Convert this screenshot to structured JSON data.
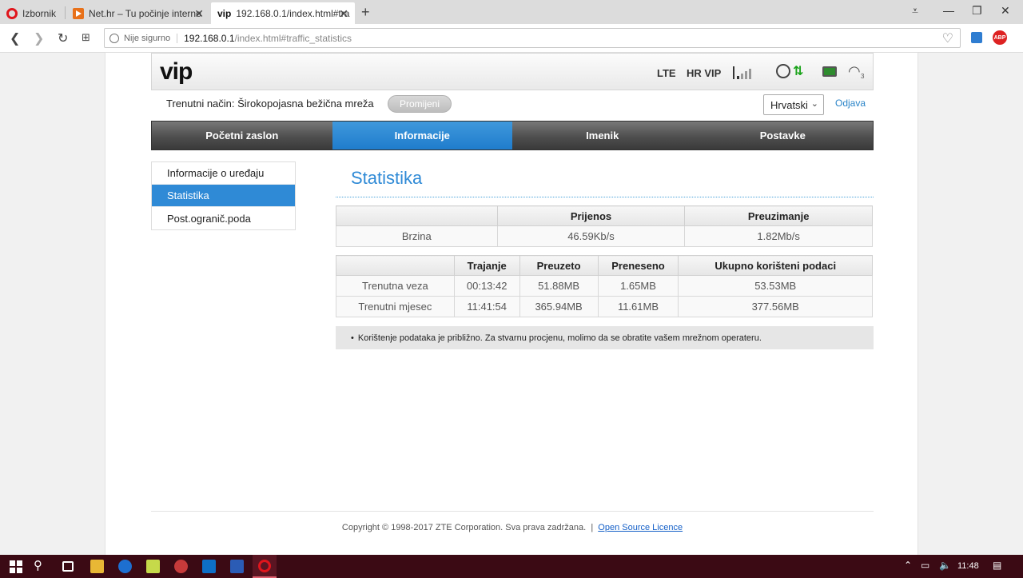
{
  "browser": {
    "tabs": [
      {
        "label": "Izbornik",
        "icon": "opera-icon"
      },
      {
        "label": "Net.hr – Tu počinje interne",
        "icon": "nethr-icon"
      },
      {
        "label": "192.168.0.1/index.html#tra",
        "prefix": "vip",
        "icon": "vip-icon"
      }
    ],
    "security_label": "Nije sigurno",
    "url_host": "192.168.0.1",
    "url_path": "/index.html#traffic_statistics",
    "adblock_label": "ABP"
  },
  "header": {
    "logo": "vip",
    "network_type": "LTE",
    "operator": "HR VIP",
    "wifi_clients": "3"
  },
  "modebar": {
    "mode_text": "Trenutni način: Širokopojasna bežična mreža",
    "change_button": "Promijeni",
    "language": "Hrvatski",
    "logout": "Odjava"
  },
  "nav": {
    "tabs": [
      "Početni zaslon",
      "Informacije",
      "Imenik",
      "Postavke"
    ],
    "active": 1
  },
  "sidemenu": {
    "items": [
      "Informacije o uređaju",
      "Statistika",
      "Post.ogranič.poda"
    ],
    "active": 1
  },
  "content": {
    "title": "Statistika",
    "speed_table": {
      "headers": [
        "",
        "Prijenos",
        "Preuzimanje"
      ],
      "rows": [
        [
          "Brzina",
          "46.59Kb/s",
          "1.82Mb/s"
        ]
      ]
    },
    "usage_table": {
      "headers": [
        "",
        "Trajanje",
        "Preuzeto",
        "Preneseno",
        "Ukupno korišteni podaci"
      ],
      "rows": [
        [
          "Trenutna veza",
          "00:13:42",
          "51.88MB",
          "1.65MB",
          "53.53MB"
        ],
        [
          "Trenutni mjesec",
          "11:41:54",
          "365.94MB",
          "11.61MB",
          "377.56MB"
        ]
      ]
    },
    "note": "Korištenje podataka je približno. Za stvarnu procjenu, molimo da se obratite vašem mrežnom operateru."
  },
  "footer": {
    "copyright": "Copyright © 1998-2017 ZTE Corporation. Sva prava zadržana.",
    "separator": "|",
    "licence_link": "Open Source Licence"
  },
  "taskbar": {
    "time": "11:48"
  },
  "colors": {
    "accent": "#2f8ad6",
    "nav_dark": "#4e4e4e",
    "taskbar": "#3b0a14"
  }
}
